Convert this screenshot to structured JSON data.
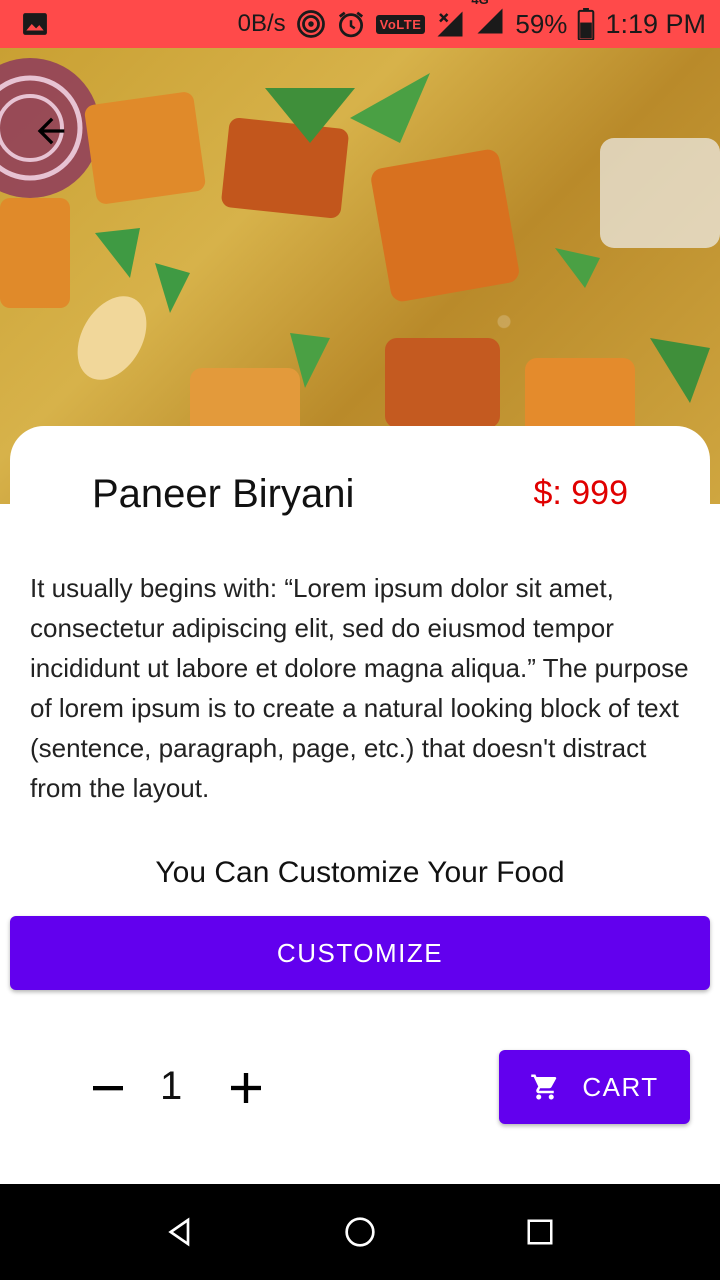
{
  "status_bar": {
    "net_speed": "0B/s",
    "volte": "VoLTE",
    "network_type": "4G",
    "battery_percent": "59%",
    "time": "1:19 PM"
  },
  "hero": {
    "image_alt": "Paneer Biryani photo"
  },
  "dish": {
    "title": "Paneer Biryani",
    "price": "$: 999",
    "description": "It usually begins with: “Lorem ipsum dolor sit amet, consectetur adipiscing elit, sed do eiusmod tempor incididunt ut labore et dolore magna aliqua.” The purpose of lorem ipsum is to create a natural looking block of text (sentence, paragraph, page, etc.) that doesn't distract from the layout."
  },
  "customize": {
    "note": "You Can Customize Your Food",
    "button_label": "CUSTOMIZE"
  },
  "quantity": {
    "value": "1"
  },
  "cart": {
    "button_label": "CART"
  },
  "colors": {
    "status_bar": "#ff4a4a",
    "accent": "#6200ee",
    "price": "#e00000"
  },
  "icons": [
    "image-icon",
    "hotspot-icon",
    "alarm-icon",
    "signal-icon",
    "battery-icon",
    "back-arrow-icon",
    "minus-icon",
    "plus-icon",
    "cart-icon",
    "nav-back-icon",
    "nav-home-icon",
    "nav-recents-icon"
  ]
}
